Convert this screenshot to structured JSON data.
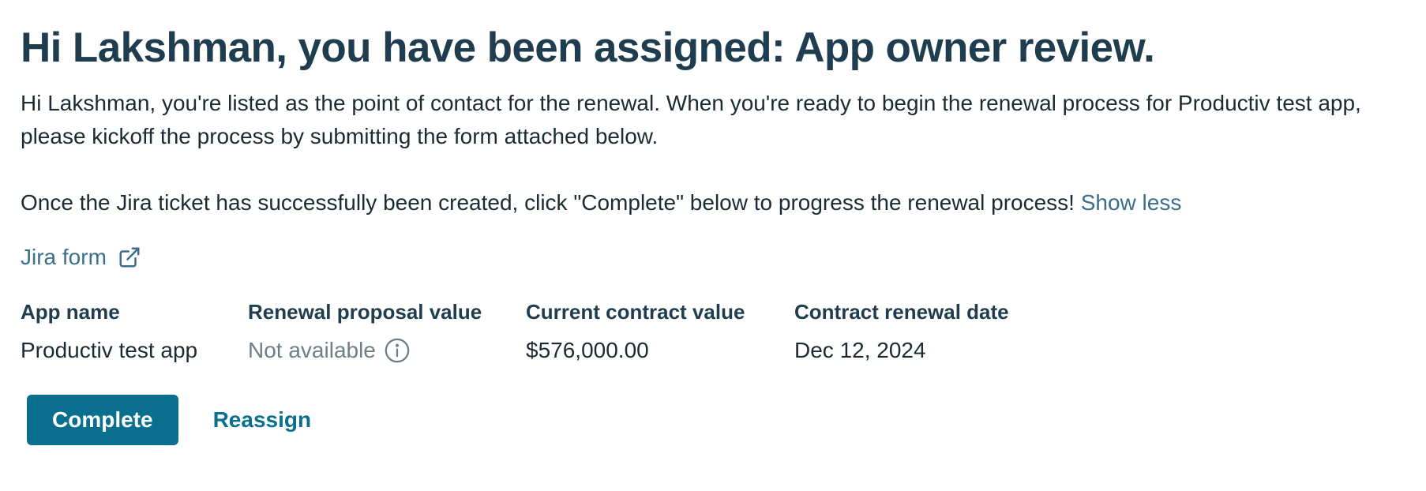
{
  "header": {
    "title": "Hi Lakshman, you have been assigned: App owner review."
  },
  "description": {
    "paragraph_1": "Hi Lakshman, you're listed as the point of contact for the renewal. When you're ready to begin the renewal process for Productiv test app, please kickoff the process by submitting the form attached below.",
    "paragraph_2": "Once the Jira ticket has successfully been created, click \"Complete\" below to progress the renewal process! ",
    "toggle_label": "Show less"
  },
  "link": {
    "label": "Jira form",
    "icon": "external-link-icon"
  },
  "details": {
    "app_name_label": "App name",
    "app_name_value": "Productiv test app",
    "renewal_proposal_label": "Renewal proposal value",
    "renewal_proposal_value": "Not available",
    "renewal_proposal_icon": "info-icon",
    "current_contract_label": "Current contract value",
    "current_contract_value": "$576,000.00",
    "renewal_date_label": "Contract renewal date",
    "renewal_date_value": "Dec 12, 2024"
  },
  "actions": {
    "complete_label": "Complete",
    "reassign_label": "Reassign"
  },
  "colors": {
    "heading": "#1f3d4f",
    "text": "#1b2a33",
    "link": "#3a6e8c",
    "primary": "#0a6f8f",
    "muted": "#6f7d86"
  }
}
